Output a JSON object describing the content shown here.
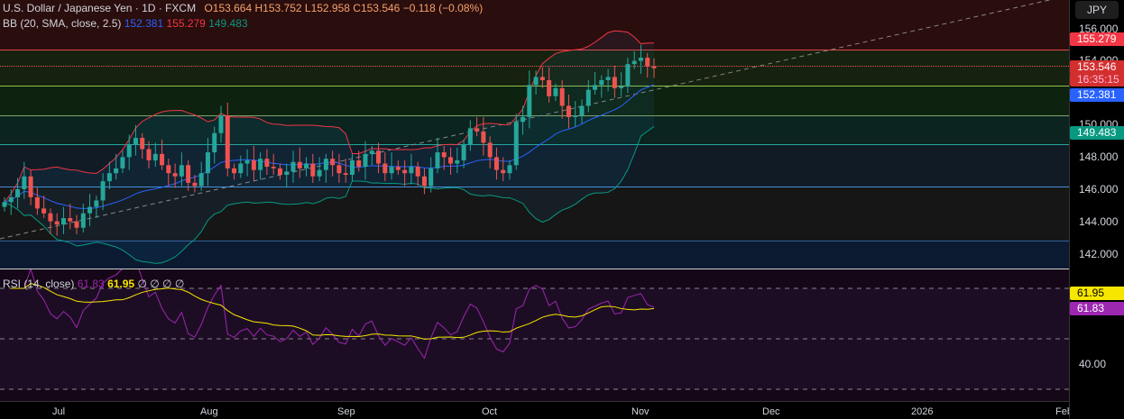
{
  "header": {
    "symbol": "U.S. Dollar / Japanese Yen · 1D · FXCM",
    "open": "O153.664",
    "high": "H153.752",
    "low": "L152.958",
    "close": "C153.546",
    "change": "−0.118 (−0.08%)"
  },
  "bb_legend": {
    "label": "BB (20, SMA, close, 2.5)",
    "basis": "152.381",
    "upper": "155.279",
    "lower": "149.483"
  },
  "rsi_legend": {
    "label": "RSI (14, close)",
    "rsi": "61.83",
    "ma": "61.95",
    "na": [
      "∅",
      "∅",
      "∅",
      "∅"
    ]
  },
  "axis": {
    "currency": "JPY",
    "ticks": [
      "156.000",
      "154.000",
      "150.000",
      "148.000",
      "146.000",
      "144.000",
      "142.000"
    ],
    "rsi_ticks": [
      "40.00"
    ],
    "labels": {
      "upper": "155.279",
      "price": "153.546",
      "countdown": "16:35:15",
      "basis": "152.381",
      "lower": "149.483",
      "rsi_ma": "61.95",
      "rsi": "61.83"
    }
  },
  "xaxis": [
    "Jul",
    "Aug",
    "Sep",
    "Oct",
    "Nov",
    "Dec",
    "2026",
    "Feb"
  ],
  "colors": {
    "up": "#26a69a",
    "down": "#ef5350",
    "upper": "#f23645",
    "basis": "#2962ff",
    "lower": "#089981",
    "rsi": "#9c27b0",
    "rsima": "#f7e600"
  },
  "chart_data": {
    "type": "candlestick",
    "title": "USD/JPY 1D",
    "ylim": [
      141,
      157
    ],
    "closes": [
      145.2,
      145.5,
      146.0,
      146.8,
      145.5,
      144.8,
      144.5,
      144.0,
      143.8,
      144.2,
      144.0,
      143.6,
      144.5,
      144.9,
      145.3,
      146.5,
      147.0,
      147.3,
      148.0,
      148.8,
      149.2,
      148.5,
      147.8,
      148.2,
      147.5,
      147.0,
      146.8,
      147.5,
      146.4,
      146.2,
      147.0,
      148.3,
      149.5,
      150.6,
      147.3,
      147.0,
      147.6,
      147.8,
      147.2,
      147.9,
      147.4,
      147.3,
      146.9,
      147.1,
      147.7,
      147.3,
      147.6,
      146.8,
      147.2,
      147.9,
      147.5,
      147.0,
      146.9,
      147.8,
      147.4,
      148.2,
      148.4,
      147.6,
      147.0,
      147.4,
      147.2,
      147.0,
      147.4,
      146.8,
      146.2,
      147.3,
      148.3,
      148.0,
      147.6,
      147.8,
      148.8,
      149.8,
      149.6,
      148.9,
      148.0,
      147.2,
      147.0,
      147.5,
      150.2,
      150.5,
      152.5,
      153.0,
      152.8,
      151.8,
      152.3,
      151.2,
      150.5,
      150.6,
      151.2,
      152.2,
      152.5,
      152.8,
      153.0,
      152.3,
      152.4,
      153.8,
      154.0,
      154.2,
      153.664,
      153.546
    ],
    "indicators": [
      "BB(20, SMA, close, 2.5)",
      "RSI(14, close)"
    ]
  }
}
